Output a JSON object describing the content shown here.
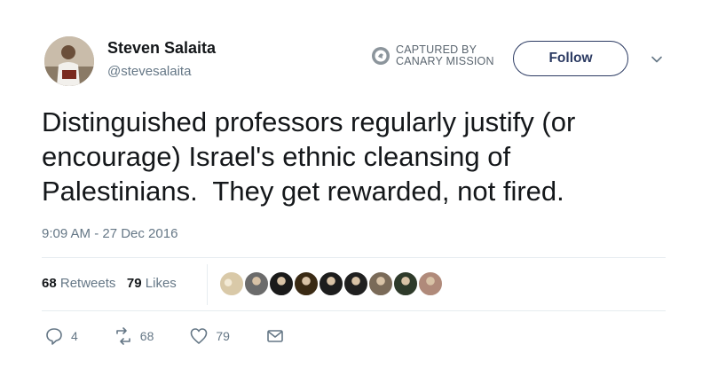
{
  "author": {
    "name": "Steven Salaita",
    "handle": "@stevesalaita"
  },
  "watermark": {
    "line1": "CAPTURED BY",
    "line2": "CANARY MISSION",
    "icon": "canary-mission-logo"
  },
  "follow_label": "Follow",
  "tweet": {
    "line1": "Distinguished professors regularly justify (or",
    "line2": "encourage) Israel's ethnic cleansing of",
    "line3": "Palestinians.  They get rewarded, not fired.",
    "timestamp": "9:09 AM - 27 Dec 2016"
  },
  "stats": {
    "retweets_count": "68",
    "retweets_label": "Retweets",
    "likes_count": "79",
    "likes_label": "Likes"
  },
  "likers": [
    "#d9c9a8",
    "#6b6b6b",
    "#1a1a1a",
    "#3a2a14",
    "#1d1d1d",
    "#202020",
    "#7a6a58",
    "#2e3a2a",
    "#b08a7a"
  ],
  "actions": {
    "reply_count": "4",
    "retweet_count": "68",
    "like_count": "79"
  },
  "colors": {
    "text": "#14171a",
    "muted": "#657786",
    "follow_border": "#2b3a62",
    "divider": "#e6ecf0"
  }
}
